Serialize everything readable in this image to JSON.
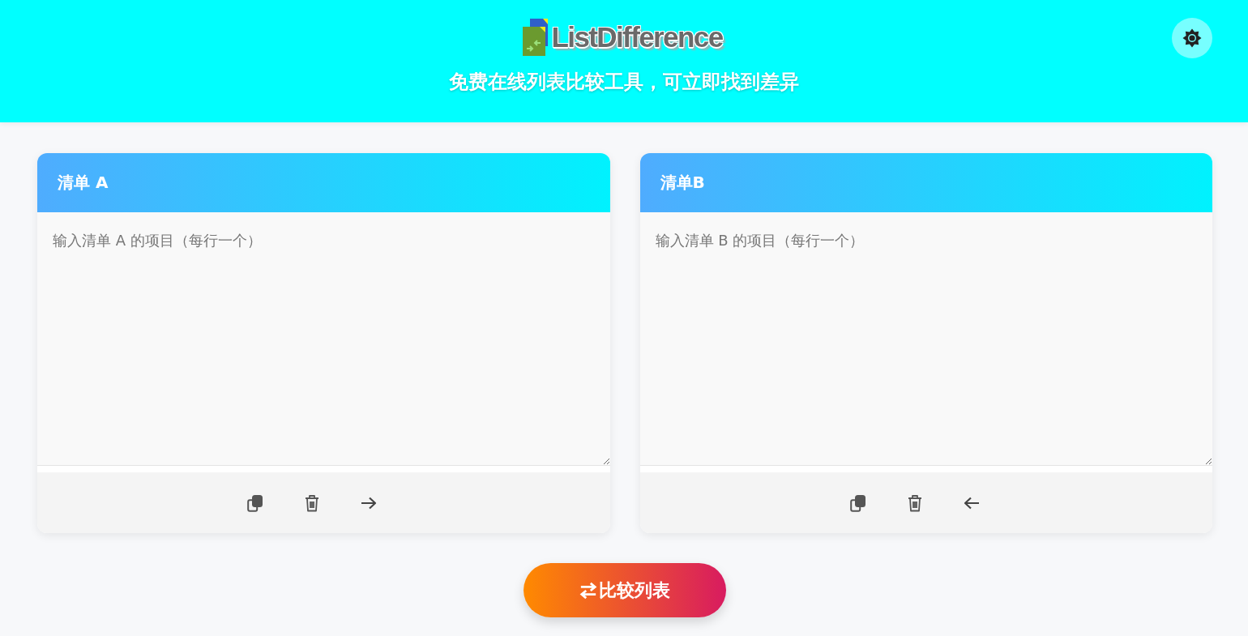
{
  "header": {
    "logo_text": "ListDifference",
    "subtitle": "免费在线列表比较工具，可立即找到差异"
  },
  "lists": [
    {
      "title": "清单 A",
      "placeholder": "输入清单 A 的项目（每行一个）",
      "actions": [
        {
          "kind": "copy"
        },
        {
          "kind": "clear"
        },
        {
          "kind": "move_right"
        }
      ]
    },
    {
      "title": "清单B",
      "placeholder": "输入清单 B 的项目（每行一个）",
      "actions": [
        {
          "kind": "copy"
        },
        {
          "kind": "clear"
        },
        {
          "kind": "move_left"
        }
      ]
    }
  ],
  "compare_button": {
    "label": "比较列表"
  }
}
